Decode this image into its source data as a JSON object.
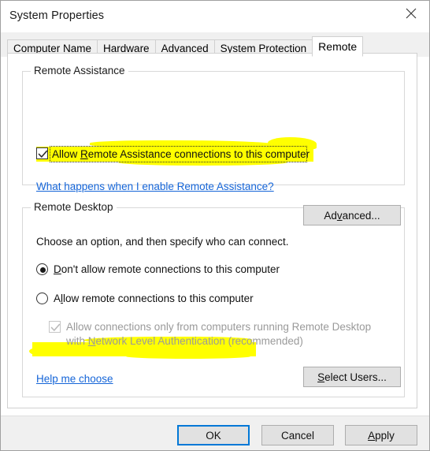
{
  "window": {
    "title": "System Properties",
    "close_icon": "close-icon"
  },
  "tabs": [
    {
      "label": "Computer Name",
      "selected": false
    },
    {
      "label": "Hardware",
      "selected": false
    },
    {
      "label": "Advanced",
      "selected": false
    },
    {
      "label": "System Protection",
      "selected": false
    },
    {
      "label": "Remote",
      "selected": true
    }
  ],
  "remote_assistance": {
    "group_title": "Remote Assistance",
    "allow_checkbox": {
      "label": "Allow Remote Assistance connections to this computer",
      "label_pre": "Allow ",
      "label_accel": "R",
      "label_post": "emote Assistance connections to this computer",
      "checked": true,
      "focused": true
    },
    "help_link": "What happens when I enable Remote Assistance?",
    "advanced_button": {
      "label": "Advanced...",
      "label_pre": "Ad",
      "label_accel": "v",
      "label_post": "anced..."
    }
  },
  "remote_desktop": {
    "group_title": "Remote Desktop",
    "instruction": "Choose an option, and then specify who can connect.",
    "options": [
      {
        "label": "Don't allow remote connections to this computer",
        "label_pre": "",
        "label_accel": "D",
        "label_post": "on't allow remote connections to this computer",
        "selected": true
      },
      {
        "label": "Allow remote connections to this computer",
        "label_pre": "A",
        "label_accel": "l",
        "label_post": "low remote connections to this computer",
        "selected": false
      }
    ],
    "nla_checkbox": {
      "line1": "Allow connections only from computers running Remote Desktop",
      "line2_pre": "with ",
      "line2_accel": "N",
      "line2_post": "etwork Level Authentication (recommended)",
      "checked": true,
      "disabled": true
    },
    "help_link": "Help me choose",
    "select_users_button": {
      "label": "Select Users...",
      "label_pre": "",
      "label_accel": "S",
      "label_post": "elect Users..."
    }
  },
  "footer": {
    "ok_button": {
      "label": "OK",
      "default": true
    },
    "cancel_button": {
      "label": "Cancel"
    },
    "apply_button": {
      "label": "Apply",
      "label_pre": "",
      "label_accel": "A",
      "label_post": "pply"
    }
  },
  "annotations": {
    "highlight_color": "#ffff00",
    "highlighted_items": [
      "Allow Remote Assistance connections to this computer",
      "Allow remote connections to this computer"
    ]
  },
  "colors": {
    "accent": "#0078d7",
    "link": "#1565d8",
    "highlight": "#ffff00",
    "button_face": "#e1e1e1"
  }
}
